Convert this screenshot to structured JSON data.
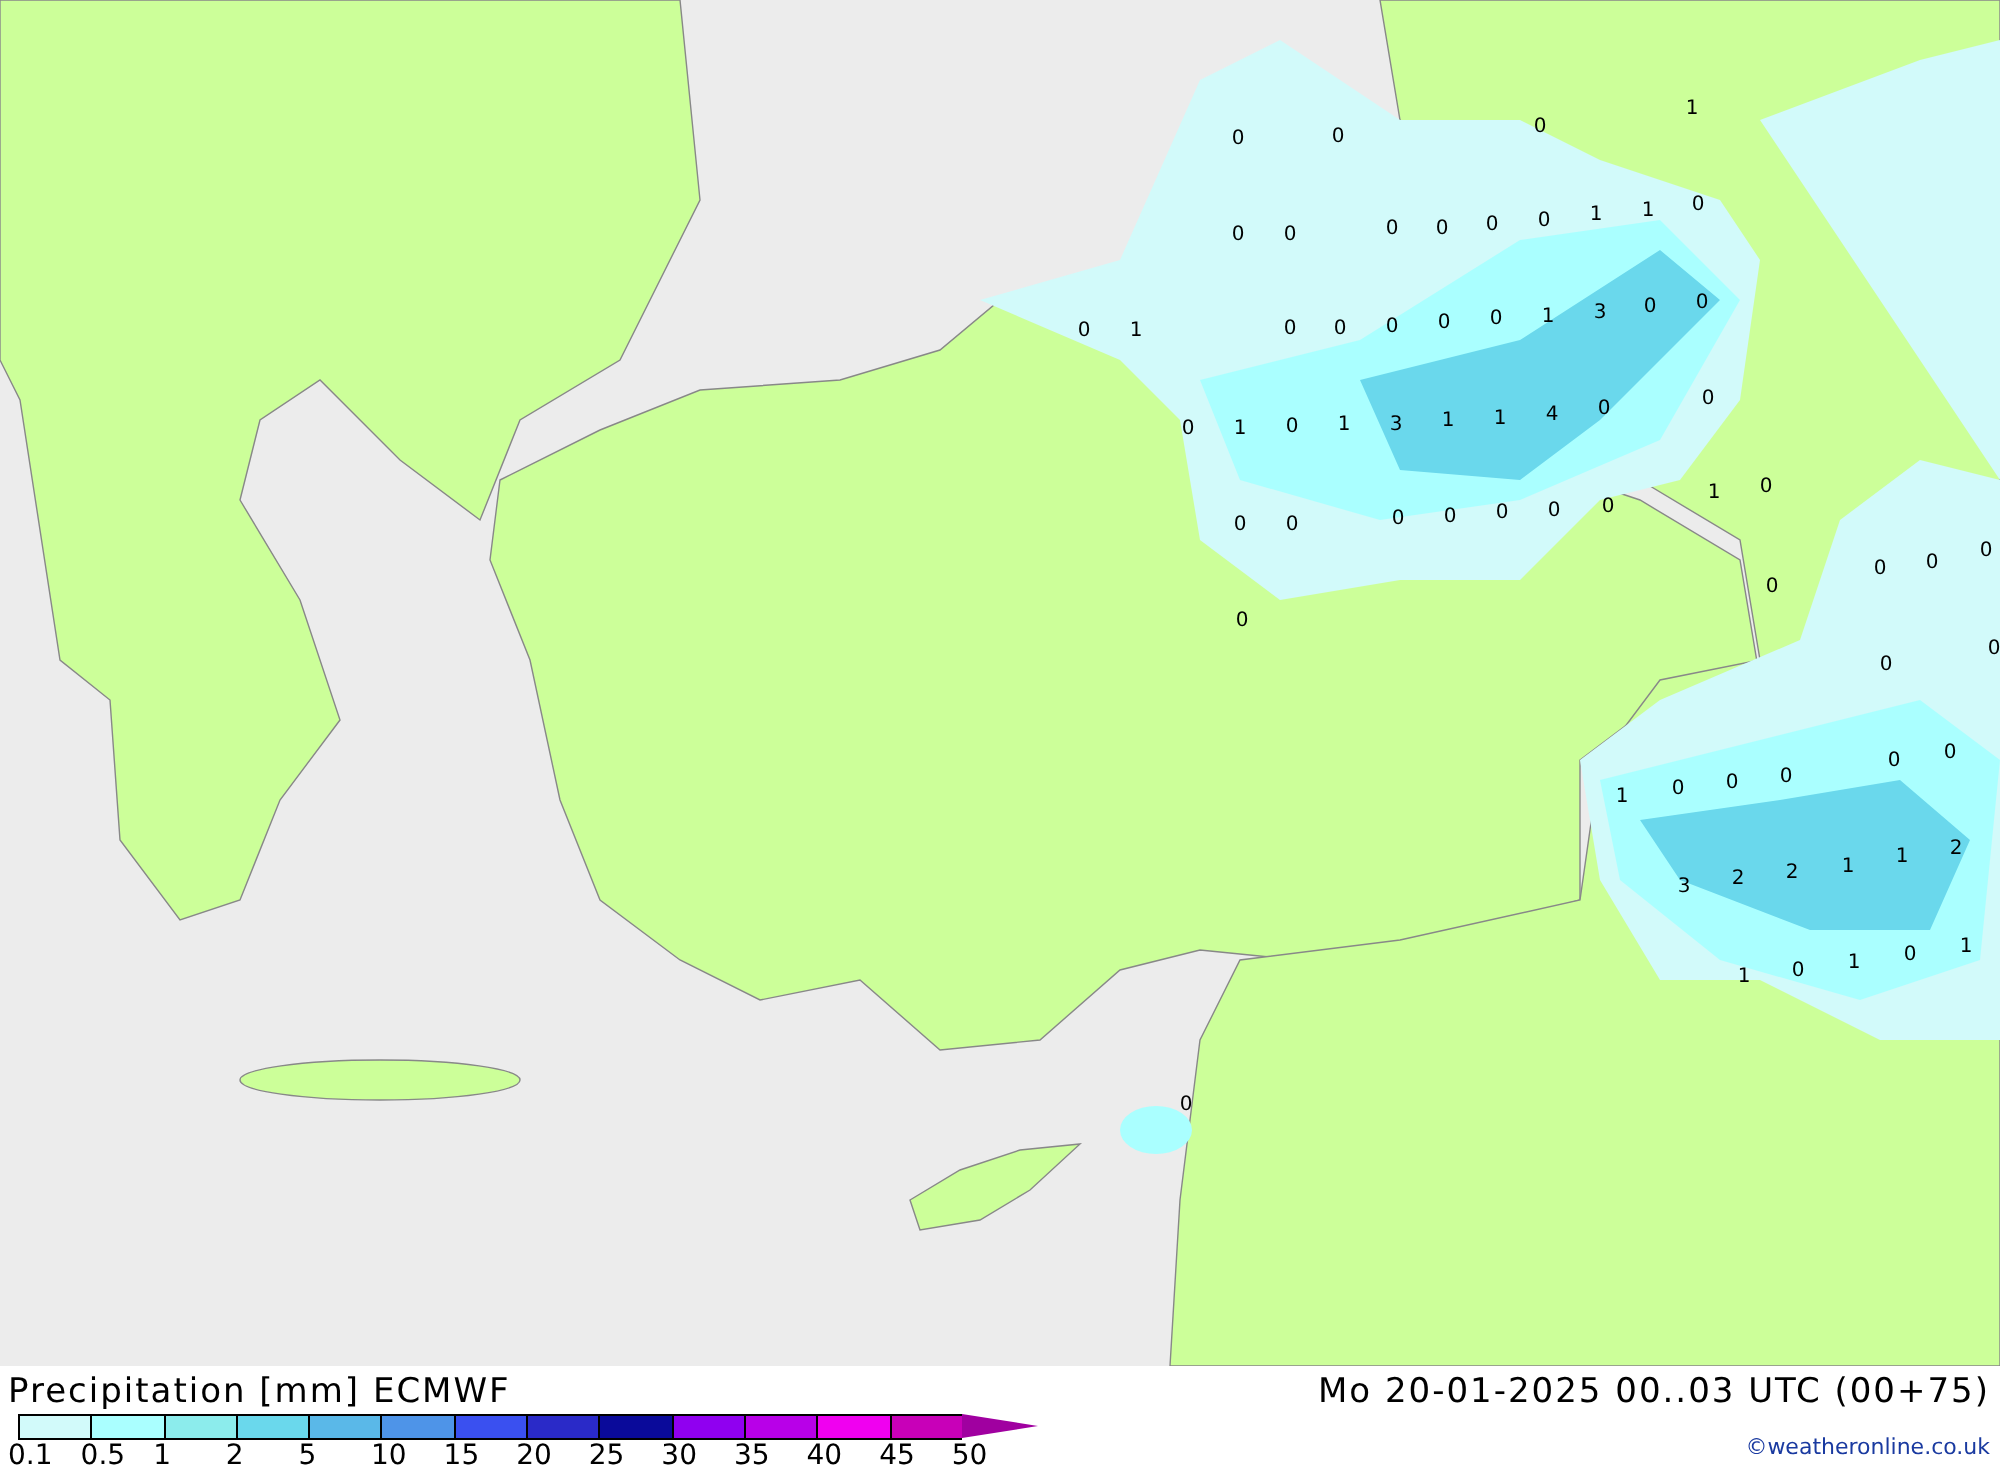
{
  "map": {
    "values": [
      "0",
      "0",
      "0",
      "1",
      "0",
      "0",
      "0",
      "0",
      "0",
      "0",
      "1",
      "1",
      "0",
      "0",
      "1",
      "0",
      "0",
      "0",
      "0",
      "0",
      "1",
      "3",
      "0",
      "0",
      "0",
      "1",
      "0",
      "1",
      "3",
      "1",
      "1",
      "4",
      "0",
      "0",
      "1",
      "0",
      "0",
      "0",
      "0",
      "0",
      "0",
      "0",
      "0",
      "0",
      "0",
      "0",
      "0",
      "0",
      "0",
      "0",
      "0",
      "0",
      "1",
      "0",
      "0",
      "0",
      "1",
      "1",
      "2",
      "3",
      "2",
      "2",
      "1",
      "0",
      "1",
      "0",
      "1",
      "0"
    ]
  },
  "legend": {
    "title": "Precipitation [mm] ECMWF",
    "segments": [
      {
        "color": "#d2fafa"
      },
      {
        "color": "#aaffff"
      },
      {
        "color": "#8cecec"
      },
      {
        "color": "#6ad8ec"
      },
      {
        "color": "#5ab8e8"
      },
      {
        "color": "#4e94e8"
      },
      {
        "color": "#3a50f0"
      },
      {
        "color": "#2a2ac8"
      },
      {
        "color": "#0a0a9a"
      },
      {
        "color": "#9000f0"
      },
      {
        "color": "#b800e8"
      },
      {
        "color": "#f000f0"
      },
      {
        "color": "#c800b8"
      }
    ],
    "ticks": [
      "0.1",
      "0.5",
      "1",
      "2",
      "5",
      "10",
      "15",
      "20",
      "25",
      "30",
      "35",
      "40",
      "45",
      "50"
    ]
  },
  "timestamp": "Mo 20-01-2025 00..03 UTC (00+75)",
  "credit": "©weatheronline.co.uk"
}
